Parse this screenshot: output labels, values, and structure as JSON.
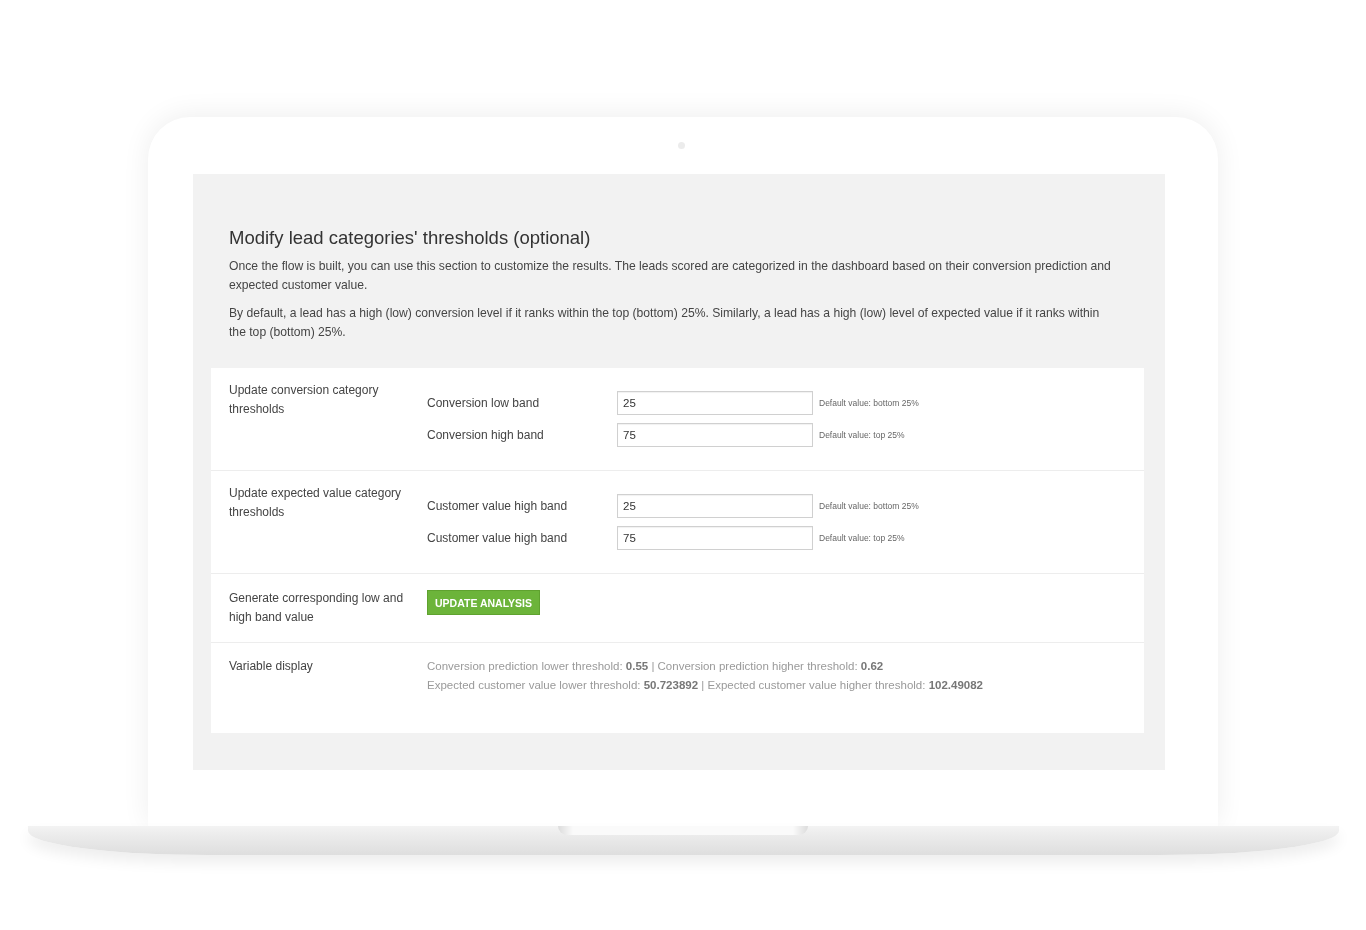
{
  "section": {
    "title": "Modify lead categories' thresholds (optional)",
    "paragraphs": [
      "Once the flow is built, you can use this section to customize the results. The leads scored are categorized in the dashboard based on their conversion prediction and expected customer value.",
      "By default, a lead has a high (low) conversion level if it ranks within the top (bottom) 25%. Similarly, a lead has a high (low) level of expected value if it ranks within the top (bottom) 25%."
    ]
  },
  "settings": [
    {
      "kind": "fields",
      "label": "Update conversion category thresholds",
      "fields": [
        {
          "label": "Conversion low band",
          "value": "25",
          "hint": "Default value: bottom 25%"
        },
        {
          "label": "Conversion high band",
          "value": "75",
          "hint": "Default value: top 25%"
        }
      ]
    },
    {
      "kind": "fields",
      "label": "Update expected value category thresholds",
      "fields": [
        {
          "label": "Customer value high band",
          "value": "25",
          "hint": "Default value: bottom 25%"
        },
        {
          "label": "Customer value high band",
          "value": "75",
          "hint": "Default value: top 25%"
        }
      ]
    },
    {
      "kind": "action",
      "label": "Generate corresponding low and high band value",
      "button": "UPDATE ANALYSIS"
    },
    {
      "kind": "display",
      "label": "Variable display",
      "lines": [
        "Conversion prediction lower threshold: **0.55** | Conversion prediction higher threshold: **0.62**",
        "Expected customer value lower threshold: **50.723892** | Expected customer value higher threshold: **102.49082**"
      ]
    }
  ]
}
